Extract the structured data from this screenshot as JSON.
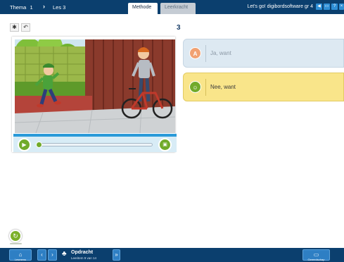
{
  "topbar": {
    "thema_label": "Thema",
    "thema_number": "1",
    "les_label": "Les 3",
    "tabs": [
      {
        "label": "Methode",
        "active": true
      },
      {
        "label": "Leerkracht",
        "active": false
      }
    ],
    "title": "Let's go! digibordsoftware gr 4",
    "icons": [
      "speaker-icon",
      "monitor-icon",
      "help-icon",
      "close-icon"
    ]
  },
  "toolbar": {
    "tools": [
      "settings-icon",
      "undo-icon"
    ]
  },
  "exercise": {
    "number": "3"
  },
  "video": {
    "controls": [
      "play-icon",
      "fullscreen-icon"
    ],
    "progress": 0.0
  },
  "answers": [
    {
      "badge": "A",
      "text": "Ja, want",
      "state": "default"
    },
    {
      "badge": "☺",
      "text": "Nee, want",
      "state": "selected"
    }
  ],
  "bottombar": {
    "home_label": "Lesmenu",
    "opdracht_title": "Opdracht",
    "opdracht_sub": "Leeritem 9 van 14",
    "tools_label": "Gereedschap"
  },
  "colors": {
    "navy": "#0b3f6e",
    "accent_blue": "#2e7fc4",
    "green": "#71aa2a",
    "answer_a_bg": "#dde9f2",
    "answer_b_bg": "#f9e58a",
    "badge_orange": "#f1a172"
  }
}
